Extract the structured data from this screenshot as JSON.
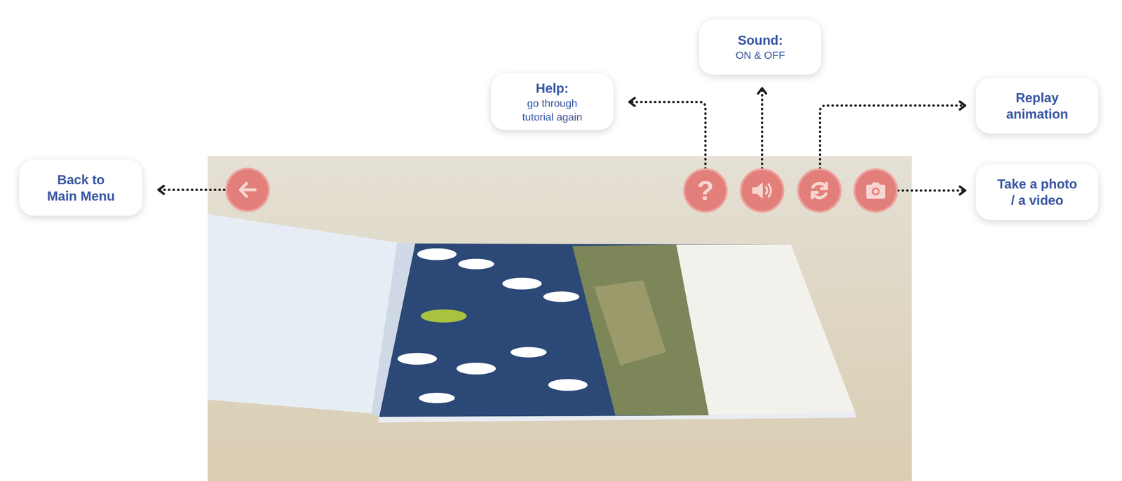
{
  "buttons": [
    {
      "kind": "back",
      "callout": {
        "title_lines": [
          "Back to",
          "Main Menu"
        ],
        "body_lines": []
      }
    },
    {
      "kind": "help",
      "label": "?",
      "callout": {
        "title_lines": [
          "Help:"
        ],
        "body_lines": [
          "go through",
          "tutorial again"
        ]
      }
    },
    {
      "kind": "sound",
      "callout": {
        "title_lines": [
          "Sound:"
        ],
        "body_lines": [
          "ON & OFF"
        ]
      }
    },
    {
      "kind": "replay",
      "callout": {
        "title_lines": [
          "Replay",
          "animation"
        ],
        "body_lines": []
      }
    },
    {
      "kind": "camera",
      "callout": {
        "title_lines": [
          "Take a photo",
          "/ a video"
        ],
        "body_lines": []
      }
    }
  ]
}
